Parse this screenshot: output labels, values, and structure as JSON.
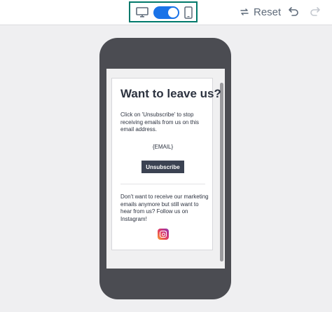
{
  "toolbar": {
    "view_toggle": {
      "selected": "mobile",
      "icons": [
        "desktop-icon",
        "mobile-icon"
      ]
    },
    "reset_label": "Reset",
    "actions": [
      "undo-icon",
      "redo-icon"
    ]
  },
  "email": {
    "heading": "Want to leave us?",
    "body": "Click on 'Unsubscribe' to stop receiving emails from us on this email address.",
    "email_token": "{EMAIL}",
    "button_label": "Unsubscribe",
    "footer": "Don't want to receive our marketing emails anymore but still want to hear from us? Follow us on Instagram!",
    "social_icon": "instagram-icon"
  },
  "colors": {
    "accent": "#1a73e8",
    "toggle_border": "#00796b",
    "button": "#3b4252",
    "phone": "#4b4c52"
  }
}
